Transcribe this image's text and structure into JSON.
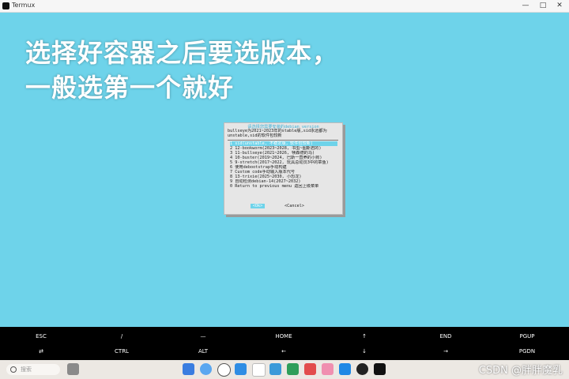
{
  "window": {
    "title": "Termux"
  },
  "caption": {
    "line1": "选择好容器之后要选版本，",
    "line2": "一般选第一个就好"
  },
  "dialog": {
    "title": "请选择您需要安装的debian version",
    "description": "bullseye为2021~2023年的stable版,sid永远都为unstable,sid的软件包较新",
    "items": [
      "1  sid(unstable, 不稳定版，软件包较新)",
      "2  12-bookworm(2023~2028, 书虫~图斯君的)",
      "3  11-bullseye(2021~2026, 犊森德的马)",
      "4  10-buster(2019~2024, 巴斯一直养的小狗)",
      "5  9-stretch(2017~2022, 玩具总动员3中的章鱼)",
      "6  使用debootstrap手动构建",
      "7  Custom code手动输入版本代号",
      "8  13-trixie(2025~2030, 小恐龙)",
      "9  自动检测debian-14(2027~2032)",
      "0  Return to previous menu 返回上级菜单"
    ],
    "ok_label": "<Ok>",
    "cancel_label": "<Cancel>"
  },
  "keys": {
    "row1": [
      "ESC",
      "/",
      "—",
      "HOME",
      "↑",
      "END",
      "PGUP"
    ],
    "row2": [
      "⇄",
      "CTRL",
      "ALT",
      "←",
      "↓",
      "→",
      "PGDN"
    ]
  },
  "taskbar": {
    "search_placeholder": "搜索",
    "watermark": "CSDN @胖胖魔乳"
  },
  "colors": {
    "terminal_bg": "#6ed3ea",
    "accent": "#6ed3ea",
    "keys_bg": "#000000",
    "taskbar_bg": "#ece8e3"
  }
}
